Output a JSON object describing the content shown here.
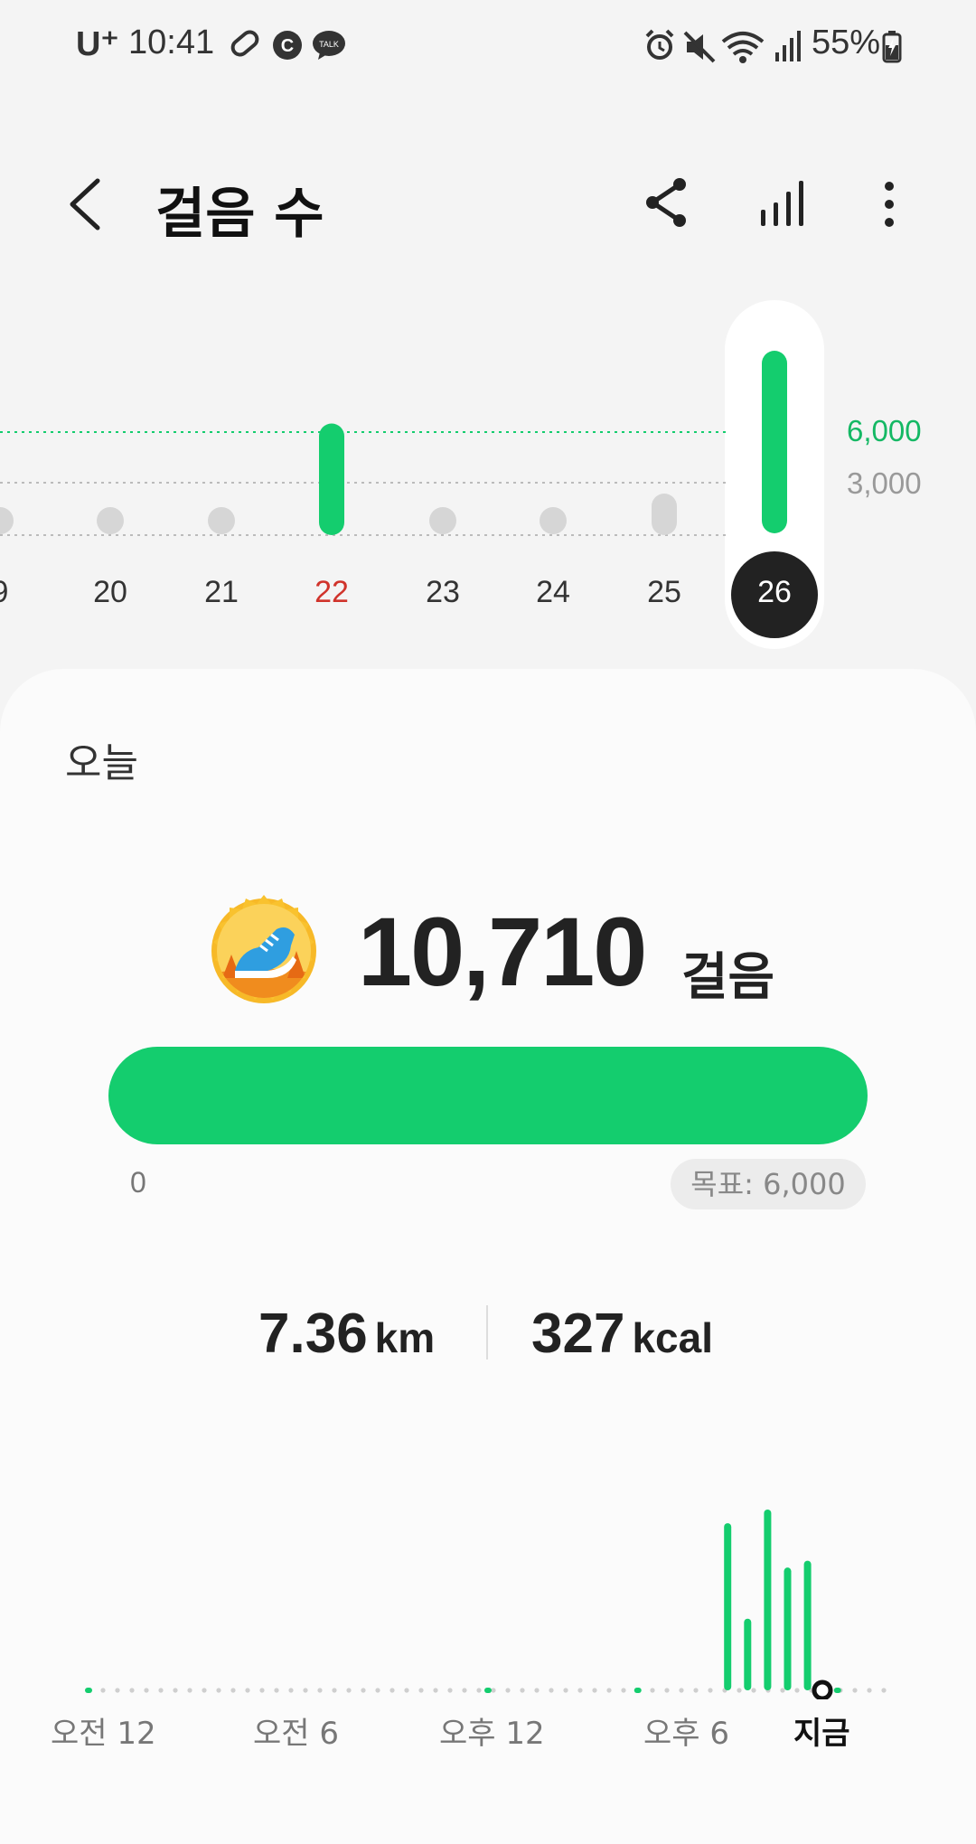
{
  "status_bar": {
    "carrier": "U⁺",
    "time": "10:41",
    "battery": "55%"
  },
  "header": {
    "title": "걸음 수",
    "back_icon": "chevron-left-icon",
    "share_icon": "share-icon",
    "trend_icon": "bar-chart-icon",
    "more_icon": "more-vertical-icon"
  },
  "week_chart": {
    "days": [
      {
        "label": "9",
        "steps": 0,
        "color": "#333333"
      },
      {
        "label": "20",
        "steps": 0,
        "color": "#333333"
      },
      {
        "label": "21",
        "steps": 0,
        "color": "#333333"
      },
      {
        "label": "22",
        "steps": 6500,
        "color": "#d0332b"
      },
      {
        "label": "23",
        "steps": 0,
        "color": "#333333"
      },
      {
        "label": "24",
        "steps": 0,
        "color": "#333333"
      },
      {
        "label": "25",
        "steps": 800,
        "color": "#333333"
      },
      {
        "label": "26",
        "steps": 10710,
        "color": "#ffffff",
        "selected": true
      }
    ],
    "goal_label": "6,000",
    "mid_label": "3,000",
    "accent": "#14cd6e"
  },
  "today": {
    "label": "오늘",
    "steps": "10,710",
    "unit": "걸음",
    "badge_icon": "running-shoe-badge-icon",
    "progress_fraction": 1.0,
    "progress_start": "0",
    "goal": "목표: 6,000",
    "distance_value": "7.36",
    "distance_unit": "km",
    "calories_value": "327",
    "calories_unit": "kcal"
  },
  "hourly_chart": {
    "labels": [
      "오전 12",
      "오전 6",
      "오후 12",
      "오후 6"
    ],
    "now_label": "지금",
    "bars": [
      {
        "hour": 19.2,
        "value": 0.98
      },
      {
        "hour": 19.8,
        "value": 0.42
      },
      {
        "hour": 20.4,
        "value": 1.06
      },
      {
        "hour": 21.0,
        "value": 0.72
      },
      {
        "hour": 21.6,
        "value": 0.76
      }
    ],
    "tiny_marks": [
      0.0,
      12.0,
      16.5,
      22.5
    ]
  }
}
